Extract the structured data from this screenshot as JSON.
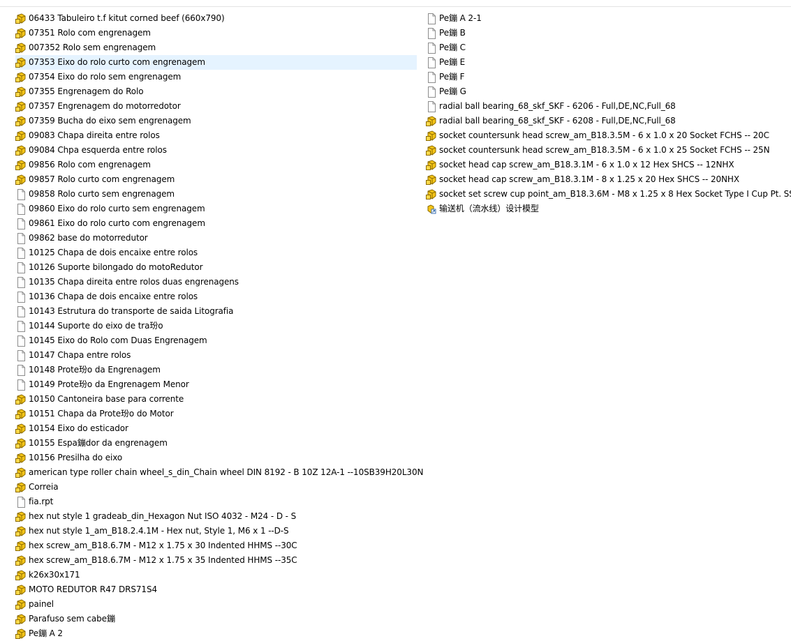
{
  "file_list": {
    "left_column": [
      {
        "name": "06433 Tabuleiro t.f kitut corned beef (660x790)",
        "icon": "solidworks-part-icon"
      },
      {
        "name": "07351 Rolo com engrenagem",
        "icon": "solidworks-part-icon"
      },
      {
        "name": "007352 Rolo sem engrenagem",
        "icon": "solidworks-part-icon"
      },
      {
        "name": "07353 Eixo do rolo curto com engrenagem",
        "icon": "solidworks-part-icon",
        "selected": true
      },
      {
        "name": "07354 Eixo do rolo sem engrenagem",
        "icon": "solidworks-part-icon"
      },
      {
        "name": "07355 Engrenagem do Rolo",
        "icon": "solidworks-part-icon"
      },
      {
        "name": "07357 Engrenagem do motorredotor",
        "icon": "solidworks-part-icon"
      },
      {
        "name": "07359 Bucha do eixo sem engrenagem",
        "icon": "solidworks-part-icon"
      },
      {
        "name": "09083 Chapa direita entre rolos",
        "icon": "solidworks-part-icon"
      },
      {
        "name": "09084 Chpa esquerda entre rolos",
        "icon": "solidworks-part-icon"
      },
      {
        "name": "09856 Rolo com engrenagem",
        "icon": "solidworks-part-icon"
      },
      {
        "name": "09857 Rolo curto com engrenagem",
        "icon": "solidworks-part-icon"
      },
      {
        "name": "09858 Rolo curto sem engrenagem",
        "icon": "blank-file-icon"
      },
      {
        "name": "09860 Eixo do rolo curto sem engrenagem",
        "icon": "blank-file-icon"
      },
      {
        "name": "09861 Eixo do rolo curto com engrenagem",
        "icon": "blank-file-icon"
      },
      {
        "name": "09862 base do motorredutor",
        "icon": "blank-file-icon"
      },
      {
        "name": "10125 Chapa de dois encaixe entre rolos",
        "icon": "blank-file-icon"
      },
      {
        "name": "10126 Suporte bilongado do motoRedutor",
        "icon": "blank-file-icon"
      },
      {
        "name": "10135 Chapa direita entre rolos duas engrenagens",
        "icon": "blank-file-icon"
      },
      {
        "name": "10136 Chapa de dois encaixe entre rolos",
        "icon": "blank-file-icon"
      },
      {
        "name": "10143 Estrutura do transporte de saida Litografia",
        "icon": "blank-file-icon"
      },
      {
        "name": "10144 Suporte do eixo de tra玢o",
        "icon": "blank-file-icon"
      },
      {
        "name": "10145 Eixo do Rolo com Duas Engrenagem",
        "icon": "blank-file-icon"
      },
      {
        "name": "10147 Chapa entre rolos",
        "icon": "blank-file-icon"
      },
      {
        "name": "10148 Prote玢o da Engrenagem",
        "icon": "blank-file-icon"
      },
      {
        "name": "10149 Prote玢o da Engrenagem Menor",
        "icon": "blank-file-icon"
      },
      {
        "name": "10150 Cantoneira base para corrente",
        "icon": "solidworks-part-icon"
      },
      {
        "name": "10151 Chapa da Prote玢o do Motor",
        "icon": "solidworks-part-icon"
      },
      {
        "name": "10154 Eixo do esticador",
        "icon": "solidworks-part-icon"
      },
      {
        "name": "10155 Espa鏰dor da engrenagem",
        "icon": "solidworks-part-icon"
      },
      {
        "name": "10156 Presilha do eixo",
        "icon": "solidworks-part-icon"
      },
      {
        "name": "american type roller chain wheel_s_din_Chain wheel DIN 8192 - B 10Z 12A-1 --10SB39H20L30N",
        "icon": "solidworks-part-icon"
      },
      {
        "name": "Correia",
        "icon": "solidworks-part-icon"
      },
      {
        "name": "fia.rpt",
        "icon": "blank-file-icon"
      },
      {
        "name": "hex nut style 1 gradeab_din_Hexagon Nut ISO 4032 - M24 - D - S",
        "icon": "solidworks-part-icon"
      },
      {
        "name": "hex nut style 1_am_B18.2.4.1M - Hex nut, Style 1,  M6 x 1 --D-S",
        "icon": "solidworks-part-icon"
      },
      {
        "name": "hex screw_am_B18.6.7M - M12 x 1.75 x 30 Indented HHMS --30C",
        "icon": "solidworks-part-icon"
      },
      {
        "name": "hex screw_am_B18.6.7M - M12 x 1.75 x 35 Indented HHMS --35C",
        "icon": "solidworks-part-icon"
      },
      {
        "name": "k26x30x171",
        "icon": "solidworks-part-icon"
      },
      {
        "name": "MOTO REDUTOR R47 DRS71S4",
        "icon": "solidworks-part-icon"
      },
      {
        "name": "painel",
        "icon": "solidworks-part-icon"
      },
      {
        "name": "Parafuso sem cabe鏰",
        "icon": "solidworks-part-icon"
      },
      {
        "name": "Pe鏰 A 2",
        "icon": "solidworks-part-icon"
      }
    ],
    "right_column": [
      {
        "name": "Pe鏰 A 2-1",
        "icon": "blank-file-icon"
      },
      {
        "name": "Pe鏰 B",
        "icon": "blank-file-icon"
      },
      {
        "name": "Pe鏰 C",
        "icon": "blank-file-icon"
      },
      {
        "name": "Pe鏰 E",
        "icon": "blank-file-icon"
      },
      {
        "name": "Pe鏰 F",
        "icon": "blank-file-icon"
      },
      {
        "name": "Pe鏰 G",
        "icon": "blank-file-icon"
      },
      {
        "name": "radial ball bearing_68_skf_SKF - 6206 - Full,DE,NC,Full_68",
        "icon": "blank-file-icon"
      },
      {
        "name": "radial ball bearing_68_skf_SKF - 6208 - Full,DE,NC,Full_68",
        "icon": "solidworks-part-icon"
      },
      {
        "name": "socket countersunk head screw_am_B18.3.5M - 6 x 1.0 x 20 Socket FCHS  -- 20C",
        "icon": "solidworks-part-icon"
      },
      {
        "name": "socket countersunk head screw_am_B18.3.5M - 6 x 1.0 x 25 Socket FCHS  -- 25N",
        "icon": "solidworks-part-icon"
      },
      {
        "name": "socket head cap screw_am_B18.3.1M - 6 x 1.0 x 12 Hex SHCS -- 12NHX",
        "icon": "solidworks-part-icon"
      },
      {
        "name": "socket head cap screw_am_B18.3.1M - 8 x 1.25 x 20 Hex SHCS -- 20NHX",
        "icon": "solidworks-part-icon"
      },
      {
        "name": "socket set screw cup point_am_B18.3.6M - M8 x 1.25 x 8 Hex Socket Type I Cup Pt. SS",
        "icon": "solidworks-part-icon"
      },
      {
        "name": "输送机（流水线）设计模型",
        "icon": "model-shortcut-icon"
      }
    ]
  },
  "colors": {
    "selected_row": "#e5f3ff",
    "part_icon_fill": "#f5c518",
    "part_icon_stroke": "#8a6a00"
  }
}
